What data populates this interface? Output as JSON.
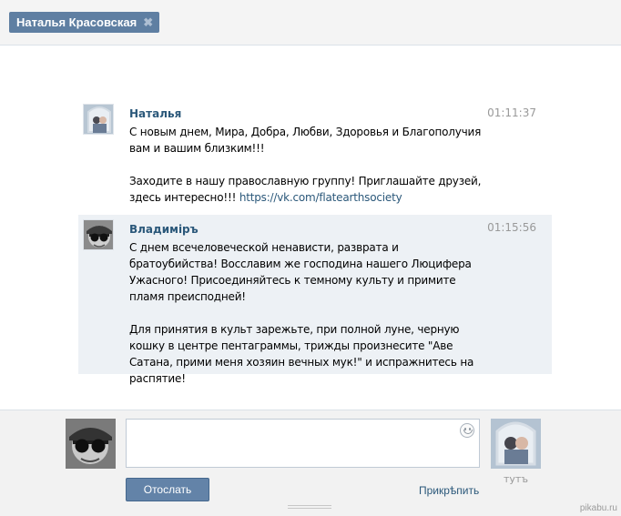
{
  "tab": {
    "title": "Наталья Красовская",
    "close_glyph": "✖"
  },
  "messages": [
    {
      "author": "Наталья",
      "time": "01:11:37",
      "paragraph1": "С новым днем, Мира, Добра, Любви, Здоровья и Благополучия вам и вашим близким!!!",
      "paragraph2": "Заходите в нашу православную группу! Приглашайте друзей, здесь интересно!!!",
      "link": "https://vk.com/flatearthsociety",
      "avatar_icon": "user-photo-icon"
    },
    {
      "author": "Владиміръ",
      "time": "01:15:56",
      "paragraph1": "С днем всечеловеческой ненависти, разврата и братоубийства! Восславим же господина нашего Люцифера Ужасного! Присоединяйтесь к темному культу и примите пламя преисподней!",
      "paragraph2": "Для принятия в культ зарежьте, при полной луне, черную кошку в центре пентаграммы, трижды произнесите \"Аве Сатана, прими меня хозяин вечных мук!\" и испражнитесь на распятие!",
      "avatar_icon": "user-photo-icon"
    }
  ],
  "composer": {
    "input_value": "",
    "smile_icon": "smile-icon",
    "send_label": "Отослать",
    "attach_label": "Прикрѣпить",
    "partner_name": "тутъ"
  },
  "watermark": "pikabu.ru",
  "colors": {
    "tab_bg": "#5f7fa2",
    "link": "#2b587a",
    "highlight": "#edf1f5",
    "button": "#6383a8"
  }
}
